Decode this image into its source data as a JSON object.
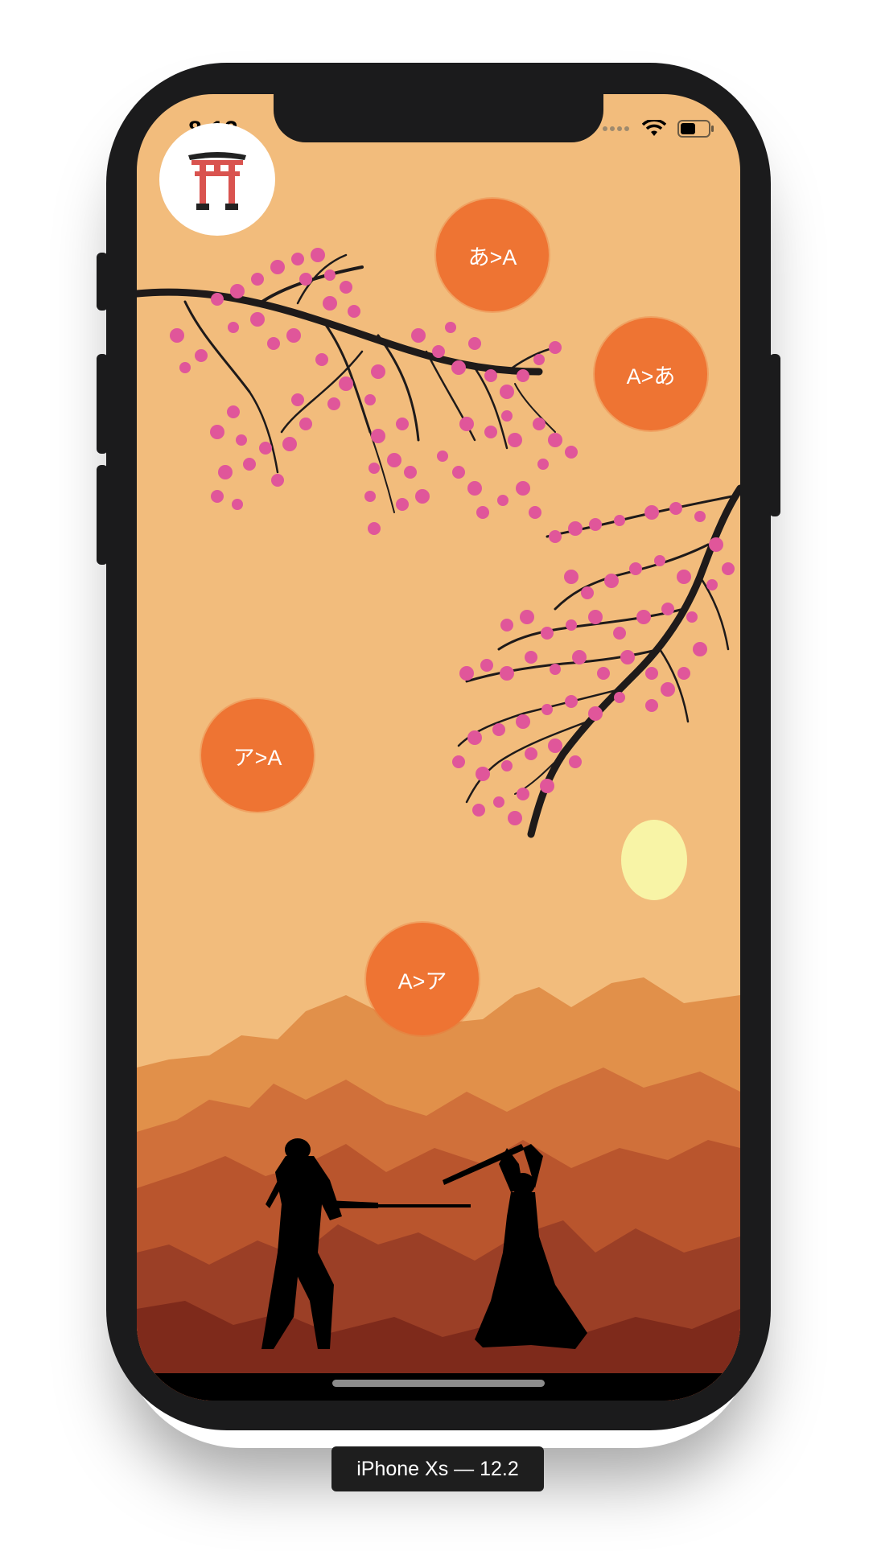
{
  "status_bar": {
    "time": "8:12"
  },
  "buttons": {
    "hiragana_to_romaji": "あ>A",
    "romaji_to_hiragana": "A>あ",
    "katakana_to_romaji": "ア>A",
    "romaji_to_katakana": "A>ア"
  },
  "icons": {
    "home": "torii-gate-icon",
    "signal": "cellular-signal-icon",
    "wifi": "wifi-icon",
    "battery": "battery-icon"
  },
  "colors": {
    "sky": "#f2bc7c",
    "button": "#ee7433",
    "moon": "#f8f4a6",
    "blossom": "#e0569a"
  },
  "simulator": {
    "device_label": "iPhone Xs — 12.2"
  }
}
